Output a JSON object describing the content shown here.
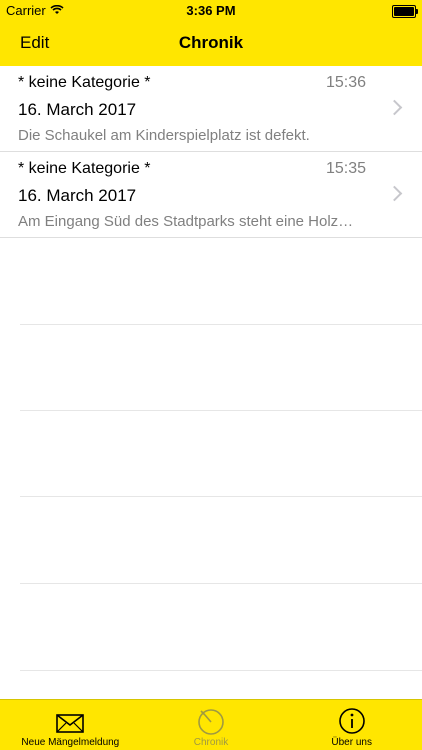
{
  "status_bar": {
    "carrier": "Carrier",
    "time": "3:36 PM"
  },
  "nav": {
    "edit_label": "Edit",
    "title": "Chronik"
  },
  "list": [
    {
      "category": "* keine Kategorie *",
      "time": "15:36",
      "date": "16. March 2017",
      "description": "Die Schaukel am Kinderspielplatz ist defekt."
    },
    {
      "category": "* keine Kategorie *",
      "time": "15:35",
      "date": "16. March 2017",
      "description": "Am Eingang Süd des Stadtparks steht eine Holz…"
    }
  ],
  "tab_bar": {
    "tabs": [
      {
        "label": "Neue Mängelmeldung",
        "icon": "envelope-icon"
      },
      {
        "label": "Chronik",
        "icon": "history-icon",
        "active": true
      },
      {
        "label": "Über uns",
        "icon": "info-icon"
      }
    ]
  },
  "colors": {
    "accent": "#FFE600",
    "secondary_text": "#808080",
    "inactive_tab": "#a09a40"
  }
}
